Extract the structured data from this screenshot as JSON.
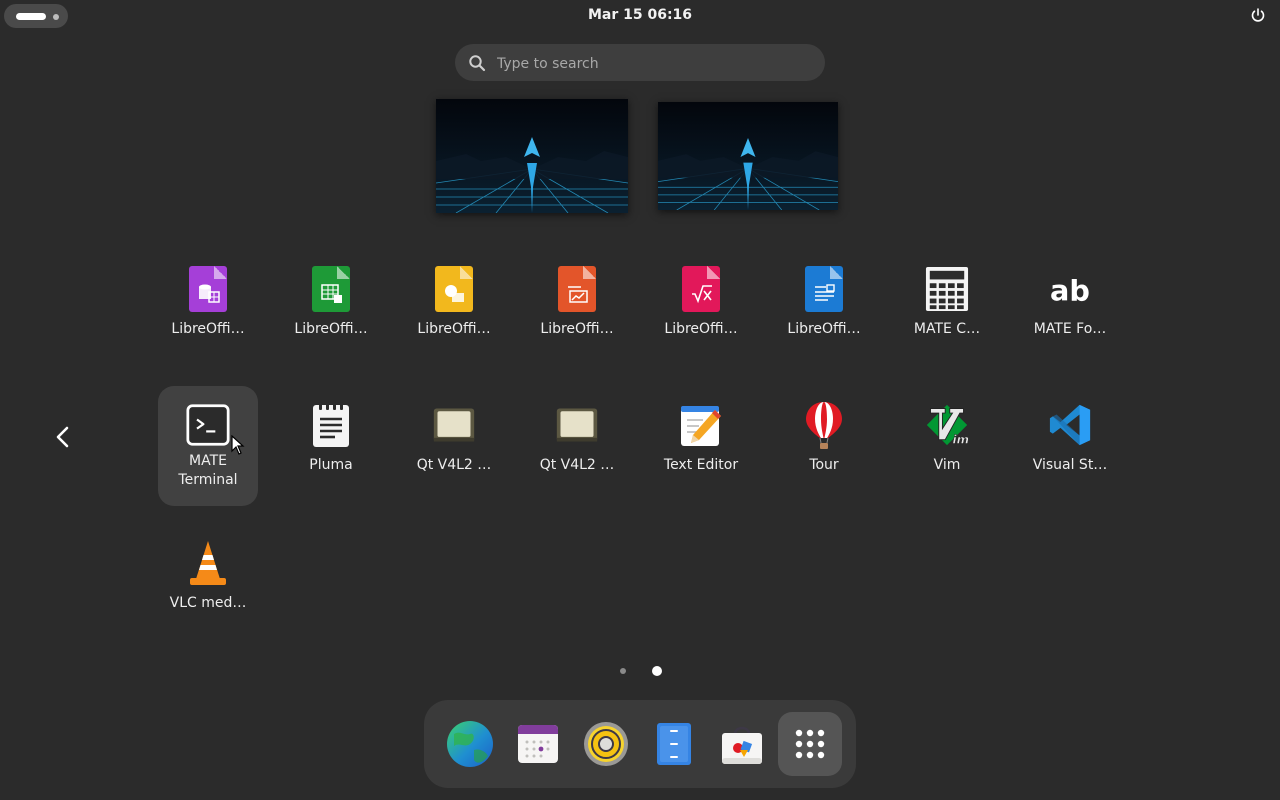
{
  "topbar": {
    "clock": "Mar 15  06:16"
  },
  "search": {
    "placeholder": "Type to search"
  },
  "apps": [
    {
      "label": "LibreOffi…",
      "icon": "libreoffice-base-icon"
    },
    {
      "label": "LibreOffi…",
      "icon": "libreoffice-calc-icon"
    },
    {
      "label": "LibreOffi…",
      "icon": "libreoffice-draw-icon"
    },
    {
      "label": "LibreOffi…",
      "icon": "libreoffice-impress-icon"
    },
    {
      "label": "LibreOffi…",
      "icon": "libreoffice-math-icon"
    },
    {
      "label": "LibreOffi…",
      "icon": "libreoffice-writer-icon"
    },
    {
      "label": "MATE C…",
      "icon": "calculator-icon"
    },
    {
      "label": "MATE Fo…",
      "icon": "font-viewer-icon"
    },
    {
      "label": "MATE Terminal",
      "icon": "terminal-icon"
    },
    {
      "label": "Pluma",
      "icon": "pluma-icon"
    },
    {
      "label": "Qt V4L2 …",
      "icon": "qt-v4l2-icon"
    },
    {
      "label": "Qt V4L2 …",
      "icon": "qt-v4l2-icon"
    },
    {
      "label": "Text Editor",
      "icon": "text-editor-icon"
    },
    {
      "label": "Tour",
      "icon": "tour-balloon-icon"
    },
    {
      "label": "Vim",
      "icon": "vim-icon"
    },
    {
      "label": "Visual St…",
      "icon": "vscode-icon"
    },
    {
      "label": "VLC med…",
      "icon": "vlc-icon"
    }
  ],
  "pagination": {
    "current": 2,
    "total": 2
  },
  "dock": [
    {
      "name": "web-browser",
      "icon": "globe-icon"
    },
    {
      "name": "calendar",
      "icon": "calendar-icon"
    },
    {
      "name": "music-player",
      "icon": "speaker-icon"
    },
    {
      "name": "files",
      "icon": "file-cabinet-icon"
    },
    {
      "name": "software",
      "icon": "software-bag-icon"
    },
    {
      "name": "show-apps",
      "icon": "app-grid-icon"
    }
  ],
  "colors": {
    "background": "#2b2b2b",
    "base": "#a33fd9",
    "calc": "#1f9a36",
    "draw": "#f2b81d",
    "impress": "#e3552a",
    "math": "#e2185a",
    "writer": "#1c7bd4"
  }
}
